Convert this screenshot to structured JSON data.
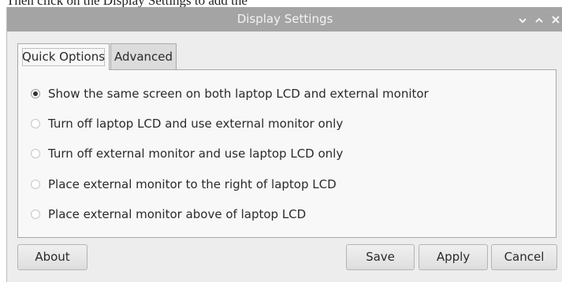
{
  "background_text": "Then click on the Display Settings to add the",
  "window": {
    "title": "Display Settings",
    "controls": {
      "minimize_icon": "chevron-down-icon",
      "maximize_icon": "chevron-up-icon",
      "close_icon": "close-icon"
    }
  },
  "tabs": [
    {
      "label": "Quick Options",
      "active": true
    },
    {
      "label": "Advanced",
      "active": false
    }
  ],
  "options": [
    {
      "label": "Show the same screen on both laptop LCD and external monitor",
      "selected": true
    },
    {
      "label": "Turn off laptop LCD and use external monitor only",
      "selected": false
    },
    {
      "label": "Turn off external monitor and use laptop LCD only",
      "selected": false
    },
    {
      "label": "Place external monitor to the right of laptop LCD",
      "selected": false
    },
    {
      "label": "Place external monitor above of laptop LCD",
      "selected": false
    }
  ],
  "buttons": {
    "about": "About",
    "save": "Save",
    "apply": "Apply",
    "cancel": "Cancel"
  },
  "colors": {
    "titlebar": "#a4a4a4",
    "window_bg": "#ededed",
    "panel_bg": "#f8f8f8"
  }
}
